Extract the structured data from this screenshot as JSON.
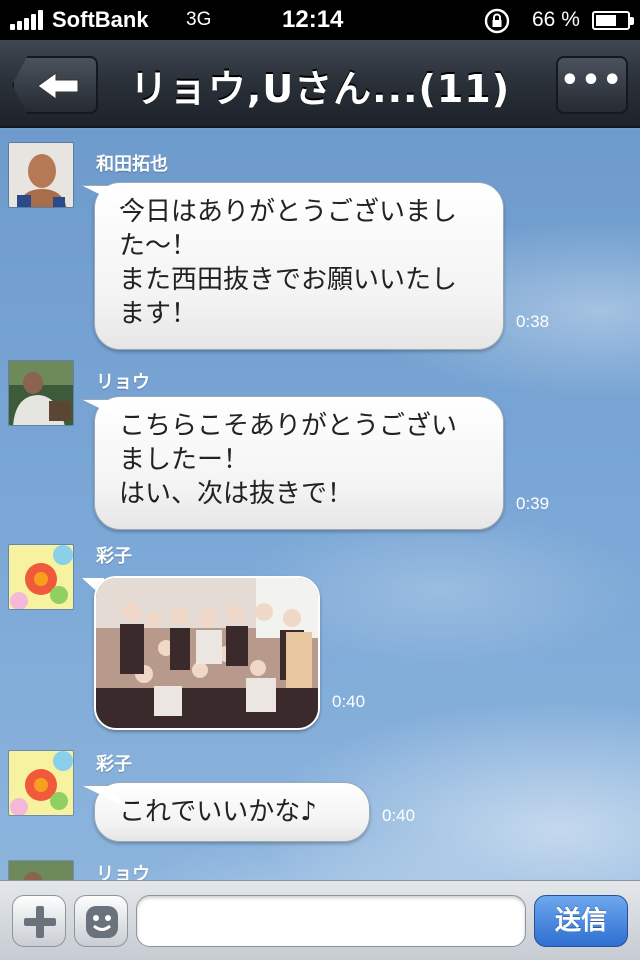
{
  "status_bar": {
    "carrier": "SoftBank",
    "network": "3G",
    "time": "12:14",
    "battery_percent": "66 %",
    "battery_level": 0.66
  },
  "header": {
    "title": "リョウ,Uさん...(11)",
    "back_icon": "back-arrow-icon",
    "more_label": "•••"
  },
  "messages": [
    {
      "sender": "和田拓也",
      "text": "今日はありがとうございました〜！\nまた西田抜きでお願いいたします！",
      "time": "0:38"
    },
    {
      "sender": "リョウ",
      "text": "こちらこそありがとうございましたー！\nはい、次は抜きで！",
      "time": "0:39"
    },
    {
      "sender": "彩子",
      "type": "photo",
      "time": "0:40"
    },
    {
      "sender": "彩子",
      "text": "これでいいかな♪",
      "time": "0:40"
    },
    {
      "sender": "リョウ"
    }
  ],
  "input_bar": {
    "add_icon": "plus-icon",
    "sticker_icon": "smiley-icon",
    "message_value": "",
    "send_label": "送信"
  },
  "colors": {
    "header_bg": "#2a3038",
    "chat_bg": "#7aa7d6",
    "send_button": "#2e6fd0"
  }
}
